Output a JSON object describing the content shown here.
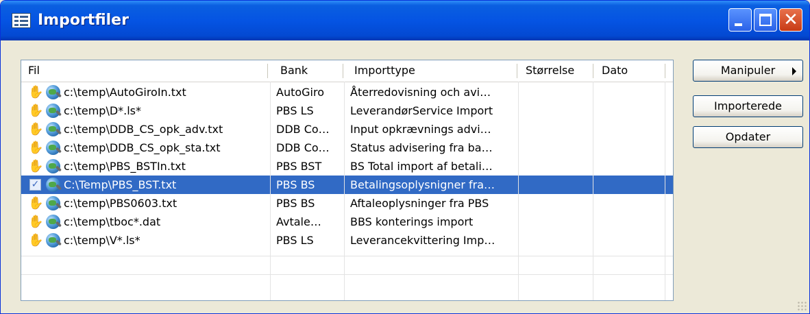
{
  "window": {
    "title": "Importfiler",
    "icon": "list-window-icon"
  },
  "titlebar_buttons": {
    "minimize_icon": "minimize-icon",
    "maximize_icon": "maximize-icon",
    "close_icon": "close-icon",
    "close_glyph": "✕"
  },
  "table": {
    "columns": [
      "Fil",
      "Bank",
      "Importtype",
      "Størrelse",
      "Dato"
    ],
    "rows": [
      {
        "status_icon": "hand-icon",
        "file": "c:\\temp\\AutoGiroIn.txt",
        "bank": "AutoGiro",
        "type": "Återredovisning och avi…",
        "size": "",
        "date": ""
      },
      {
        "status_icon": "hand-icon",
        "file": "c:\\temp\\D*.ls*",
        "bank": "PBS LS",
        "type": "LeverandørService Import",
        "size": "",
        "date": ""
      },
      {
        "status_icon": "hand-icon",
        "file": "c:\\temp\\DDB_CS_opk_adv.txt",
        "bank": "DDB Co…",
        "type": "Input opkrævnings advi…",
        "size": "",
        "date": ""
      },
      {
        "status_icon": "hand-icon",
        "file": "c:\\temp\\DDB_CS_opk_sta.txt",
        "bank": "DDB Co…",
        "type": "Status advisering fra ba…",
        "size": "",
        "date": ""
      },
      {
        "status_icon": "hand-icon",
        "file": "c:\\temp\\PBS_BSTIn.txt",
        "bank": "PBS BST",
        "type": "BS Total import af betali…",
        "size": "",
        "date": ""
      },
      {
        "status_icon": "checkbox-icon",
        "file": "C:\\Temp\\PBS_BST.txt",
        "bank": "PBS BS",
        "type": "Betalingsoplysnigner fra…",
        "size": "",
        "date": "",
        "selected": true
      },
      {
        "status_icon": "hand-icon",
        "file": "c:\\temp\\PBS0603.txt",
        "bank": "PBS BS",
        "type": "Aftaleoplysninger fra PBS",
        "size": "",
        "date": ""
      },
      {
        "status_icon": "hand-icon",
        "file": "c:\\temp\\tboc*.dat",
        "bank": "Avtale…",
        "type": "BBS konterings import",
        "size": "",
        "date": ""
      },
      {
        "status_icon": "hand-icon",
        "file": "c:\\temp\\V*.ls*",
        "bank": "PBS LS",
        "type": "Leverancekvittering Imp…",
        "size": "",
        "date": ""
      }
    ]
  },
  "buttons": {
    "manipuler": "Manipuler",
    "importerede": "Importerede",
    "opdater": "Opdater"
  },
  "colors": {
    "selection": "#316ac5",
    "titlebar": "#0554e3",
    "window_bg": "#ece9d8"
  }
}
